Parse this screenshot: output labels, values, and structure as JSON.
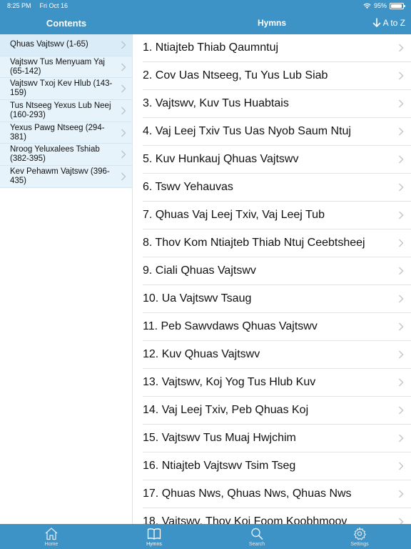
{
  "status_bar": {
    "time": "8:25 PM",
    "date": "Fri Oct 16",
    "battery_text": "95%",
    "battery_level": 0.95
  },
  "nav": {
    "sidebar_title": "Contents",
    "main_title": "Hymns",
    "sort_label": "A to Z"
  },
  "sidebar": {
    "items": [
      {
        "label": "Qhuas Vajtswv (1-65)"
      },
      {
        "label": "Vajtswv Tus Menyuam Yaj (65-142)"
      },
      {
        "label": "Vajtswv Txoj Kev Hlub (143-159)"
      },
      {
        "label": "Tus Ntseeg Yexus Lub Neej (160-293)"
      },
      {
        "label": "Yexus Pawg Ntseeg (294-381)"
      },
      {
        "label": "Nroog Yeluxalees Tshiab (382-395)"
      },
      {
        "label": "Kev Pehawm Vajtswv (396-435)"
      }
    ]
  },
  "hymns": [
    {
      "title": "1. Ntiajteb Thiab Qaumntuj"
    },
    {
      "title": "2. Cov Uas Ntseeg, Tu Yus Lub Siab"
    },
    {
      "title": "3. Vajtswv, Kuv Tus Huabtais"
    },
    {
      "title": "4. Vaj Leej Txiv Tus Uas Nyob Saum Ntuj"
    },
    {
      "title": "5. Kuv Hunkauj Qhuas Vajtswv"
    },
    {
      "title": "6. Tswv Yehauvas"
    },
    {
      "title": "7. Qhuas Vaj Leej Txiv, Vaj Leej Tub"
    },
    {
      "title": "8. Thov Kom Ntiajteb Thiab Ntuj Ceebtsheej"
    },
    {
      "title": "9. Ciali Qhuas Vajtswv"
    },
    {
      "title": "10. Ua Vajtswv Tsaug"
    },
    {
      "title": "11. Peb Sawvdaws Qhuas Vajtswv"
    },
    {
      "title": "12. Kuv Qhuas Vajtswv"
    },
    {
      "title": "13. Vajtswv, Koj Yog Tus Hlub Kuv"
    },
    {
      "title": "14. Vaj Leej Txiv, Peb Qhuas Koj"
    },
    {
      "title": "15. Vajtswv Tus Muaj Hwjchim"
    },
    {
      "title": "16. Ntiajteb Vajtswv Tsim Tseg"
    },
    {
      "title": "17. Qhuas Nws, Qhuas Nws, Qhuas Nws"
    },
    {
      "title": "18. Vajtswv, Thov Koj Foom Koobhmoov"
    }
  ],
  "tabs": [
    {
      "label": "Home",
      "icon": "home-icon"
    },
    {
      "label": "Hymns",
      "icon": "book-icon"
    },
    {
      "label": "Search",
      "icon": "search-icon"
    },
    {
      "label": "Settings",
      "icon": "gear-icon"
    }
  ],
  "colors": {
    "accent": "#3d93c6",
    "sidebar_bg": "#e6f3fb"
  }
}
